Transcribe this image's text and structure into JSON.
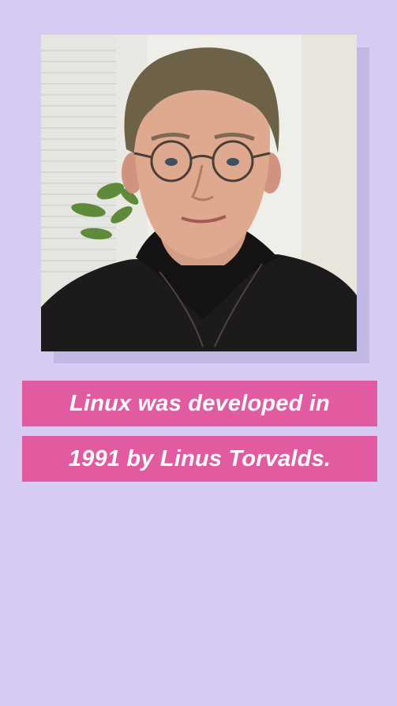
{
  "colors": {
    "background": "#d6ccf3",
    "photo_shadow": "#c2b8e6",
    "caption_bar": "#e25aa0",
    "caption_text": "#ffffff"
  },
  "photo": {
    "subject_icon": "portrait-photo"
  },
  "caption": {
    "line1": "Linux was developed in",
    "line2": "1991 by Linus Torvalds."
  }
}
